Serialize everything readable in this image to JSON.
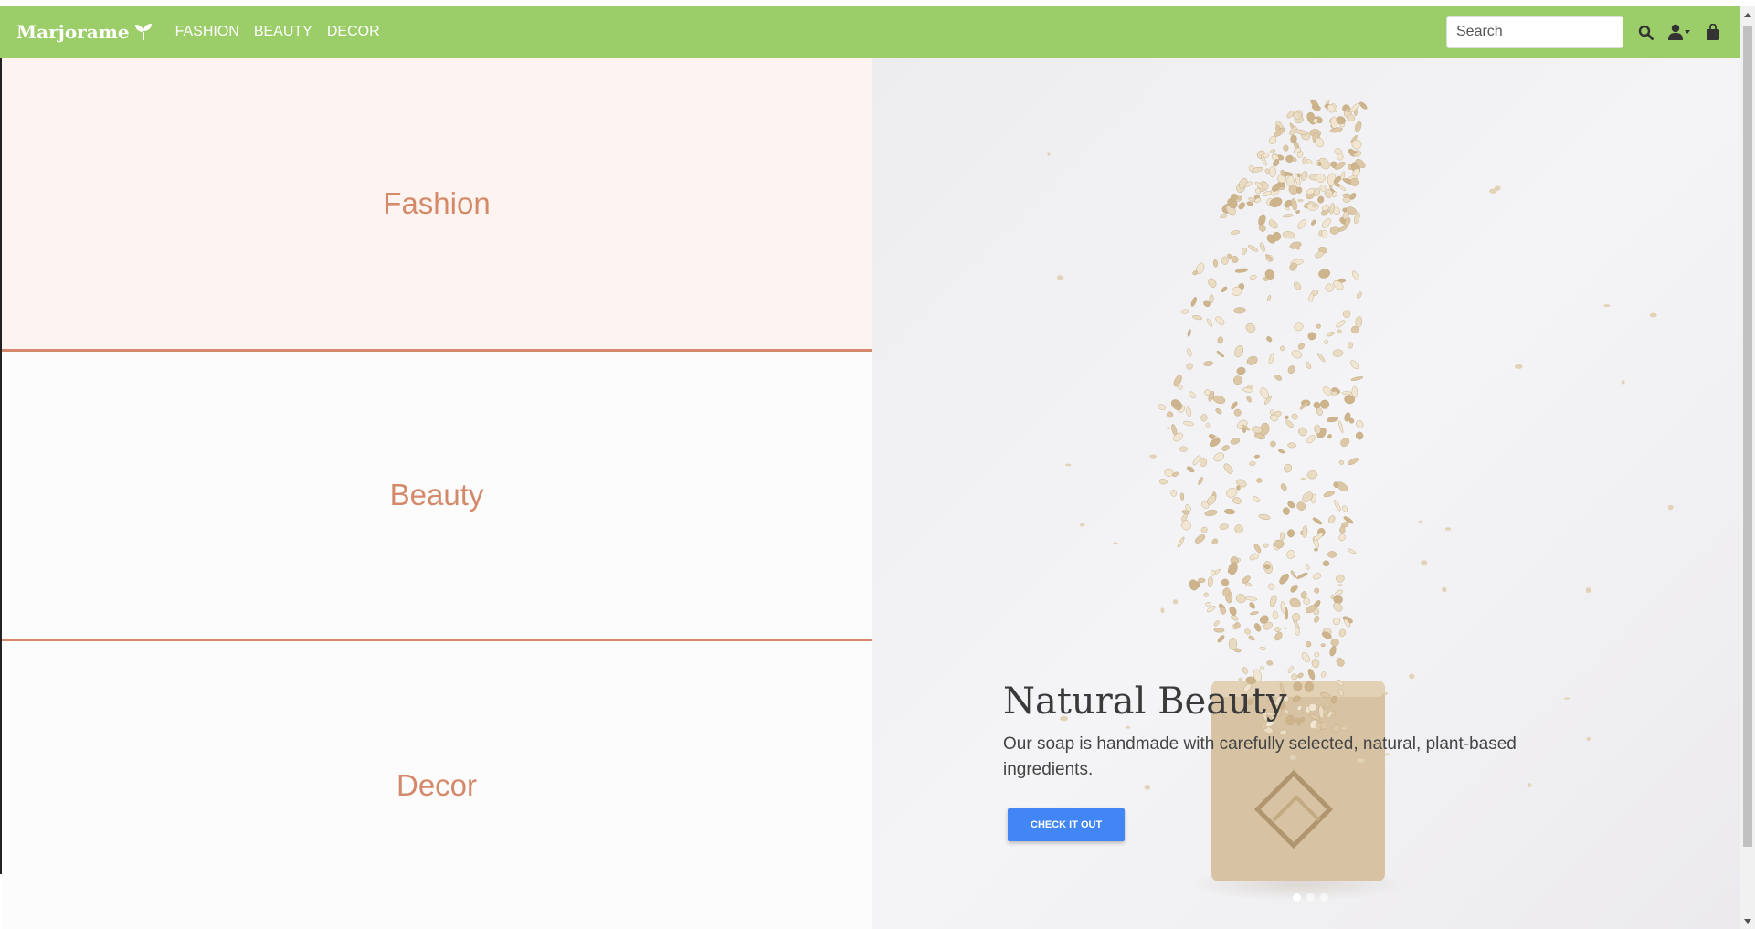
{
  "brand": {
    "name": "Marjorame",
    "icon": "sprout-icon"
  },
  "nav": {
    "links": [
      {
        "label": "FASHION"
      },
      {
        "label": "BEAUTY"
      },
      {
        "label": "DECOR"
      }
    ],
    "search_placeholder": "Search",
    "icons": [
      "search-icon",
      "user-icon",
      "shopping-bag-icon"
    ]
  },
  "panels": [
    {
      "label": "Fashion"
    },
    {
      "label": "Beauty"
    },
    {
      "label": "Decor"
    }
  ],
  "hero": {
    "title": "Natural Beauty",
    "text": "Our soap is handmade with carefully selected, natural, plant-based ingredients.",
    "cta_label": "CHECK IT OUT",
    "slides": 3,
    "active_slide": 1
  },
  "colors": {
    "navbar": "#9bcd69",
    "accent": "#d48a6a",
    "cta": "#4285f4",
    "panel_fashion_bg": "#fdf4f1"
  }
}
